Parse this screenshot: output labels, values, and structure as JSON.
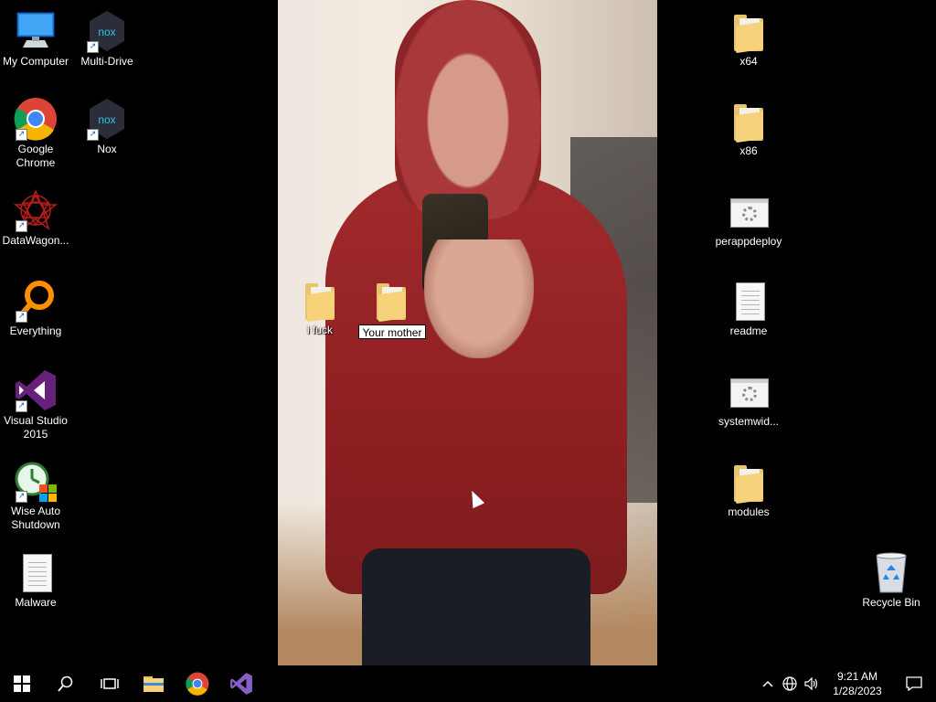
{
  "desktop": {
    "left_icons": [
      {
        "label": "My Computer",
        "icon": "computer-icon",
        "shortcut": false
      },
      {
        "label": "Multi-Drive",
        "icon": "nox-icon",
        "shortcut": true
      },
      {
        "label": "Google Chrome",
        "icon": "chrome-icon",
        "shortcut": true
      },
      {
        "label": "Nox",
        "icon": "nox-icon",
        "shortcut": true
      },
      {
        "label": "DataWagon...",
        "icon": "datawagon-icon",
        "shortcut": true
      },
      {
        "label": "Everything",
        "icon": "everything-icon",
        "shortcut": true
      },
      {
        "label": "Visual Studio 2015",
        "icon": "visual-studio-icon",
        "shortcut": true
      },
      {
        "label": "Wise Auto Shutdown",
        "icon": "wise-auto-shutdown-icon",
        "shortcut": true
      },
      {
        "label": "Malware",
        "icon": "document-icon",
        "shortcut": false
      }
    ],
    "middle_icons": [
      {
        "label": "i fuck",
        "icon": "folder-icon"
      },
      {
        "label": "Your mother",
        "icon": "folder-icon",
        "renaming": true
      }
    ],
    "right_icons": [
      {
        "label": "x64",
        "icon": "folder-icon"
      },
      {
        "label": "x86",
        "icon": "folder-icon"
      },
      {
        "label": "perappdeploy",
        "icon": "config-file-icon"
      },
      {
        "label": "readme",
        "icon": "document-icon"
      },
      {
        "label": "systemwid...",
        "icon": "config-file-icon"
      },
      {
        "label": "modules",
        "icon": "folder-icon"
      },
      {
        "label": "Recycle Bin",
        "icon": "recycle-bin-icon"
      }
    ]
  },
  "taskbar": {
    "pinned": [
      {
        "name": "start-button",
        "glyph": "⊞"
      },
      {
        "name": "search-button",
        "glyph": "⌕"
      },
      {
        "name": "task-view-button",
        "glyph": "▭"
      },
      {
        "name": "file-explorer-button",
        "glyph": ""
      },
      {
        "name": "chrome-button",
        "glyph": ""
      },
      {
        "name": "visual-studio-button",
        "glyph": ""
      }
    ],
    "tray": {
      "chevron": "^",
      "network": "🌐",
      "volume": "🔊",
      "time": "9:21 AM",
      "date": "1/28/2023"
    }
  },
  "colors": {
    "taskbar_bg": "#000000",
    "folder": "#f6d37a",
    "chrome_red": "#db4437",
    "chrome_green": "#0f9d58",
    "chrome_yellow": "#f4b400",
    "chrome_blue": "#4285f4",
    "vs_purple": "#68217a",
    "nox_dark": "#2b2e38",
    "nox_cyan": "#2fc4e8"
  }
}
